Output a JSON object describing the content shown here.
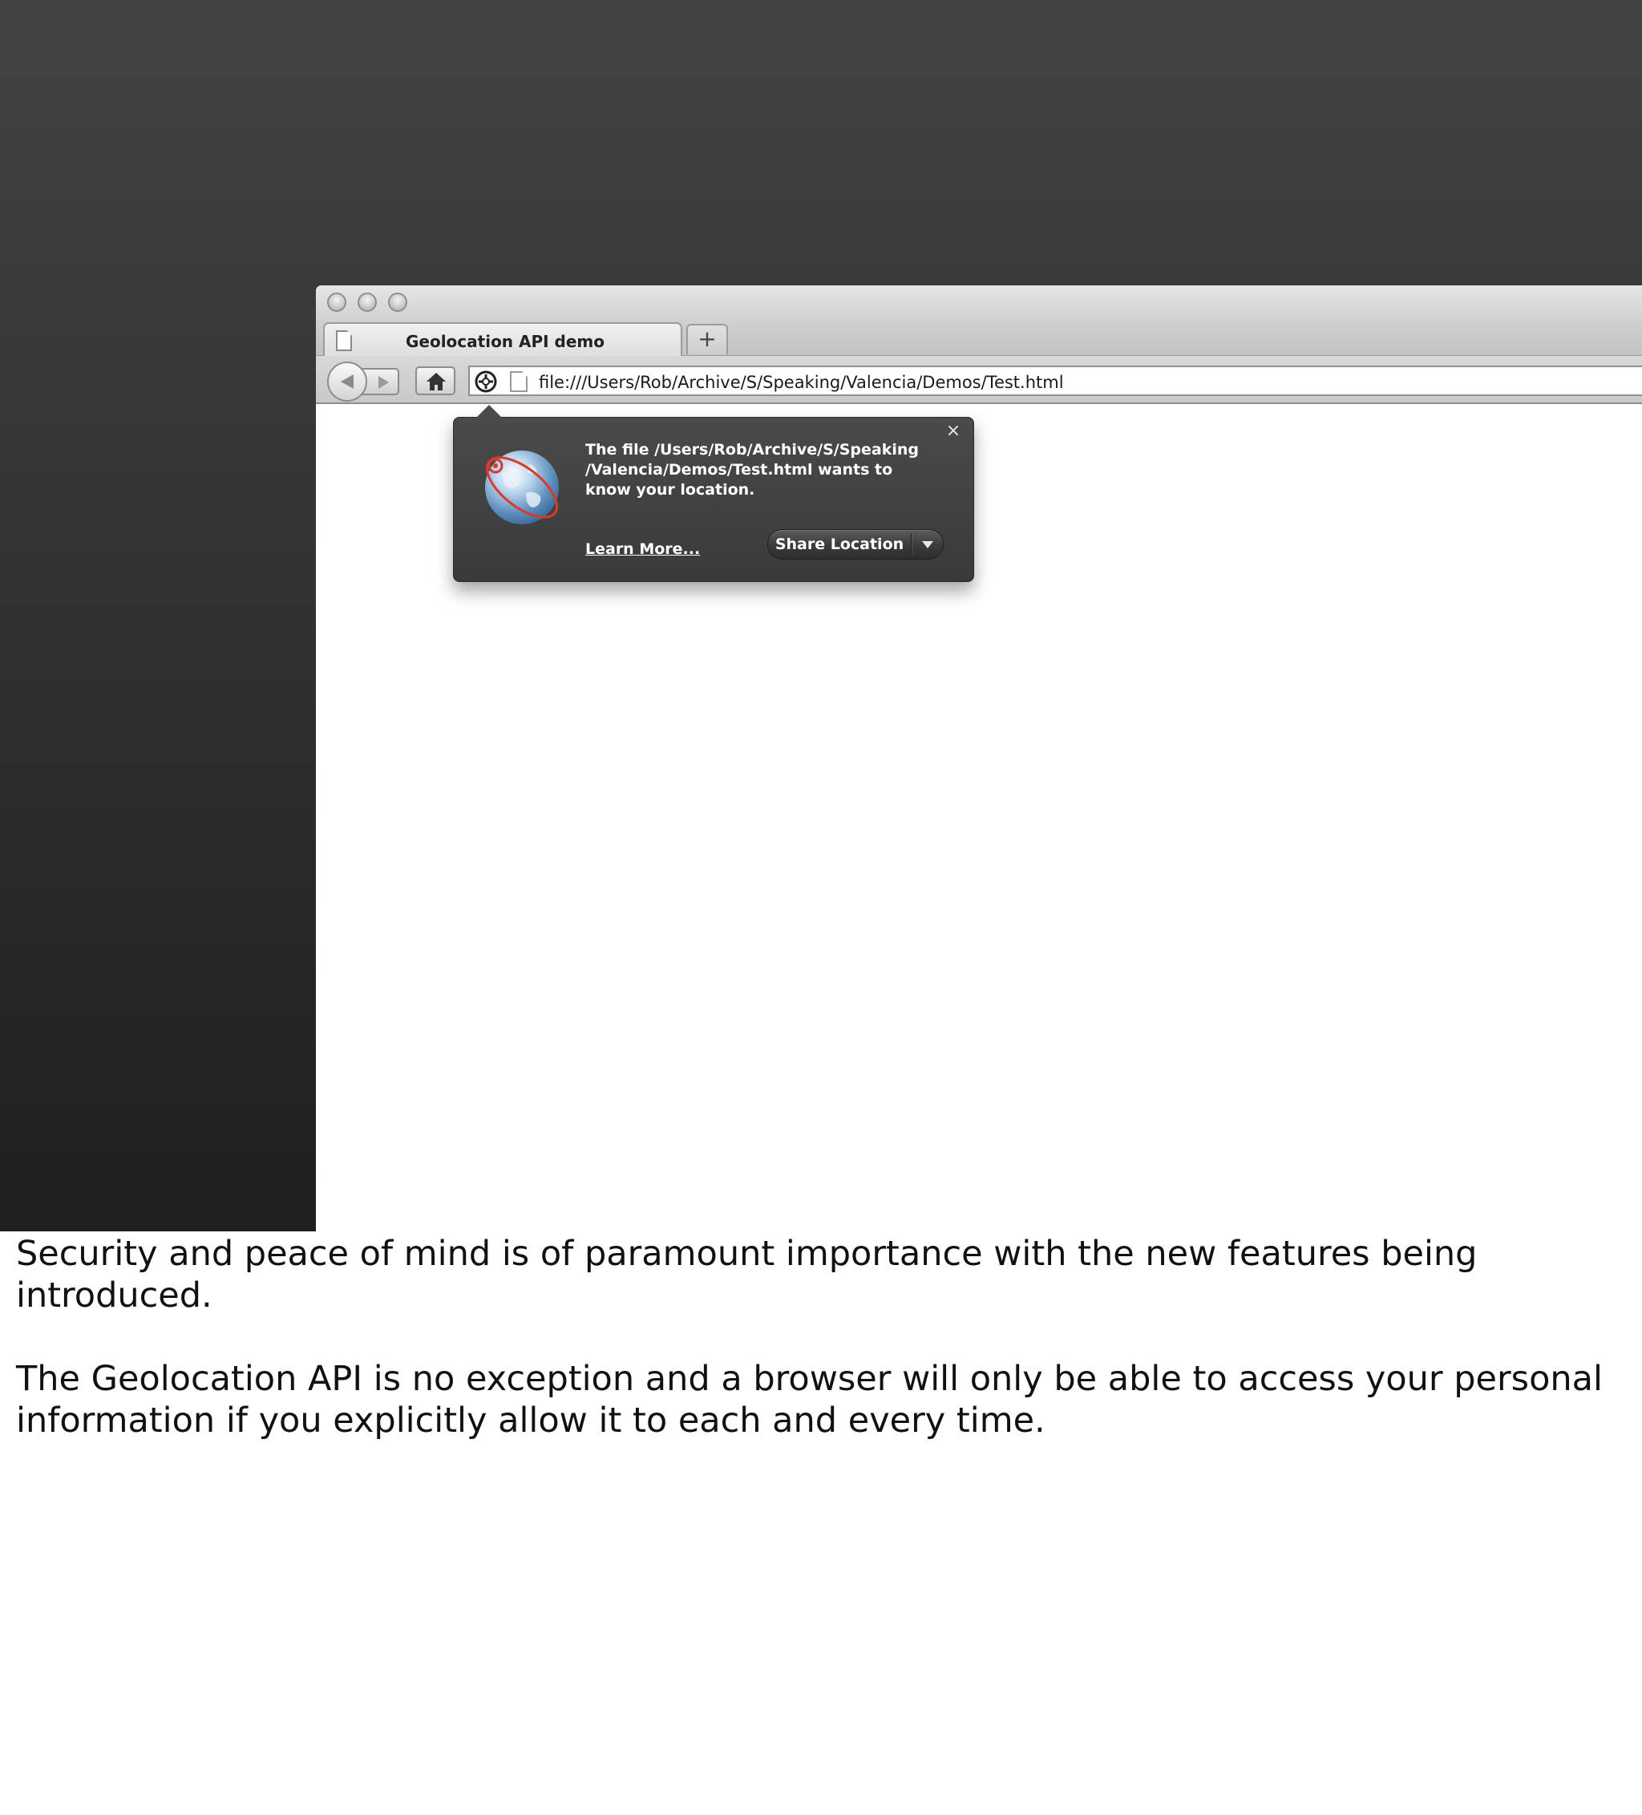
{
  "browser": {
    "tab": {
      "title": "Geolocation API demo",
      "new_tab_symbol": "+"
    },
    "url": "file:///Users/Rob/Archive/S/Speaking/Valencia/Demos/Test.html",
    "toolbar_icons": [
      "back-arrow-icon",
      "forward-arrow-icon",
      "home-icon",
      "location-crosshair-icon",
      "page-icon"
    ]
  },
  "geo_prompt": {
    "close_symbol": "×",
    "message": "The file /Users/Rob/Archive/S/Speaking /Valencia/Demos/Test.html wants to know your location.",
    "learn_more_label": "Learn More...",
    "share_button_label": "Share Location",
    "icon": "globe-icon",
    "dropdown_icon": "chevron-down-icon"
  },
  "notes": {
    "paragraph1": "Security and peace of mind is of paramount importance with the new features being introduced.",
    "paragraph2": "The Geolocation API is no exception and a browser will only be able to access your personal information if you explicitly allow it to each and every time."
  },
  "colors": {
    "slide_background_top": "#434343",
    "slide_background_bottom": "#1f1f1f",
    "popup_background": "#3f3f3f",
    "globe_orbit": "#d93a2b"
  }
}
